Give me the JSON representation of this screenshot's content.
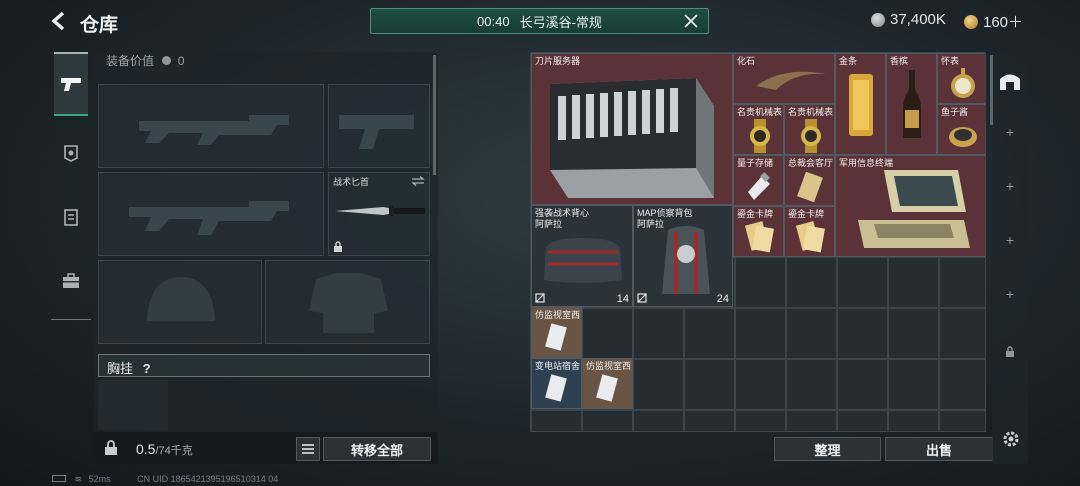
{
  "header": {
    "title": "仓库",
    "match_time": "00:40",
    "match_name": "长弓溪谷-常规",
    "currency1": "37,400K",
    "currency2": "160＋"
  },
  "equipment": {
    "value_label": "装备价值",
    "value": "0",
    "knife_label": "战术匕首",
    "chest_label": "胸挂",
    "weight_value": "0.5",
    "weight_max": "/74千克",
    "transfer_all": "转移全部"
  },
  "stash": {
    "items": [
      {
        "label": "刀片服务器"
      },
      {
        "label": "化石"
      },
      {
        "label": "金条"
      },
      {
        "label": "香槟"
      },
      {
        "label": "怀表"
      },
      {
        "label": "名贵机械表"
      },
      {
        "label": "名贵机械表"
      },
      {
        "label": "鱼子酱"
      },
      {
        "label": "量子存储"
      },
      {
        "label": "总裁会客厅"
      },
      {
        "label": "军用信息终端"
      },
      {
        "label": "强袭战术背心\n阿萨拉",
        "count": "14"
      },
      {
        "label": "MAP侦察背包\n阿萨拉",
        "count": "24"
      },
      {
        "label": "鎏金卡牌"
      },
      {
        "label": "鎏金卡牌"
      },
      {
        "label": "仿监视室西"
      },
      {
        "label": "变电站宿舍"
      },
      {
        "label": "仿监视室西"
      }
    ],
    "sort_button": "整理",
    "sell_button": "出售"
  },
  "footer": {
    "ping": "52ms",
    "uid": "CN UID 1865421395196510314 04"
  },
  "colors": {
    "rare_red": "#5b3237",
    "accent_green": "#3fa38a",
    "match_bar": "#1f4d45"
  }
}
